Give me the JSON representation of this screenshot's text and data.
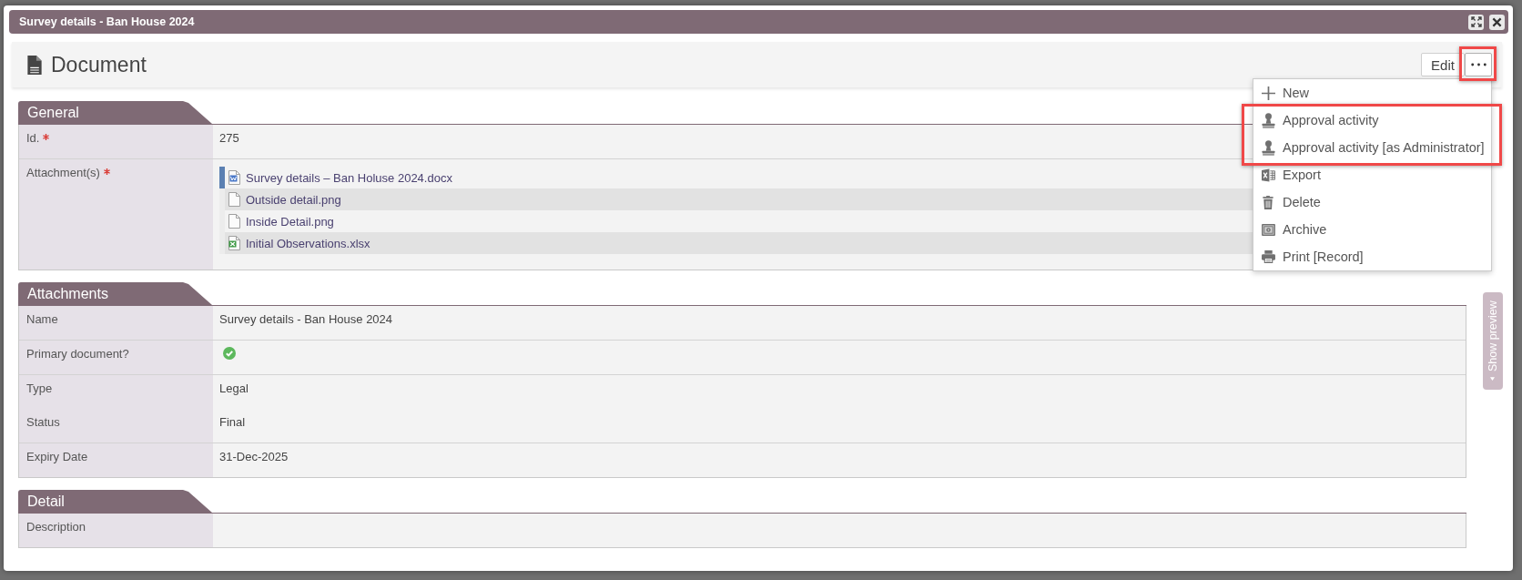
{
  "window": {
    "title": "Survey details - Ban House 2024",
    "controls": [
      {
        "kind": "maximize"
      },
      {
        "kind": "close"
      }
    ]
  },
  "header": {
    "title": "Document",
    "edit_button": {
      "label": "Edit"
    },
    "more_button": {
      "highlighted": true
    },
    "menu": {
      "open": true,
      "items": [
        {
          "kind": "new",
          "label": "New",
          "highlighted": false
        },
        {
          "kind": "approval",
          "label": "Approval activity",
          "highlighted": true
        },
        {
          "kind": "approval",
          "label": "Approval activity [as Administrator]",
          "highlighted": true
        },
        {
          "kind": "export",
          "label": "Export",
          "highlighted": false
        },
        {
          "kind": "delete",
          "label": "Delete",
          "highlighted": false
        },
        {
          "kind": "archive",
          "label": "Archive",
          "highlighted": false
        },
        {
          "kind": "print",
          "label": "Print [Record]",
          "highlighted": false
        }
      ]
    }
  },
  "sections": [
    {
      "title": "General",
      "groups": [
        {
          "fields": [
            {
              "kind": "text",
              "label": "Id.",
              "required": true,
              "value": "275"
            }
          ]
        },
        {
          "fields": [
            {
              "kind": "files",
              "label": "Attachment(s)",
              "required": true,
              "files": [
                {
                  "kind": "word",
                  "name": "Survey details – Ban Holuse 2024.docx",
                  "selected": true
                },
                {
                  "kind": "image",
                  "name": "Outside detail.png",
                  "selected": false
                },
                {
                  "kind": "image",
                  "name": "Inside Detail.png",
                  "selected": false
                },
                {
                  "kind": "spreadsheet",
                  "name": "Initial Observations.xlsx",
                  "selected": false
                }
              ]
            }
          ]
        }
      ]
    },
    {
      "title": "Attachments",
      "groups": [
        {
          "fields": [
            {
              "kind": "text",
              "label": "Name",
              "required": false,
              "value": "Survey details - Ban House 2024"
            }
          ]
        },
        {
          "fields": [
            {
              "kind": "check",
              "label": "Primary document?",
              "required": false,
              "checked": true
            }
          ]
        },
        {
          "fields": [
            {
              "kind": "text",
              "label": "Type",
              "required": false,
              "value": "Legal"
            },
            {
              "kind": "text",
              "label": "Status",
              "required": false,
              "value": "Final"
            }
          ]
        },
        {
          "fields": [
            {
              "kind": "text",
              "label": "Expiry Date",
              "required": false,
              "value": "31-Dec-2025"
            }
          ]
        }
      ]
    },
    {
      "title": "Detail",
      "groups": [
        {
          "fields": [
            {
              "kind": "text",
              "label": "Description",
              "required": false
            }
          ]
        }
      ]
    }
  ],
  "preview_tab": {
    "label": "Show preview"
  }
}
